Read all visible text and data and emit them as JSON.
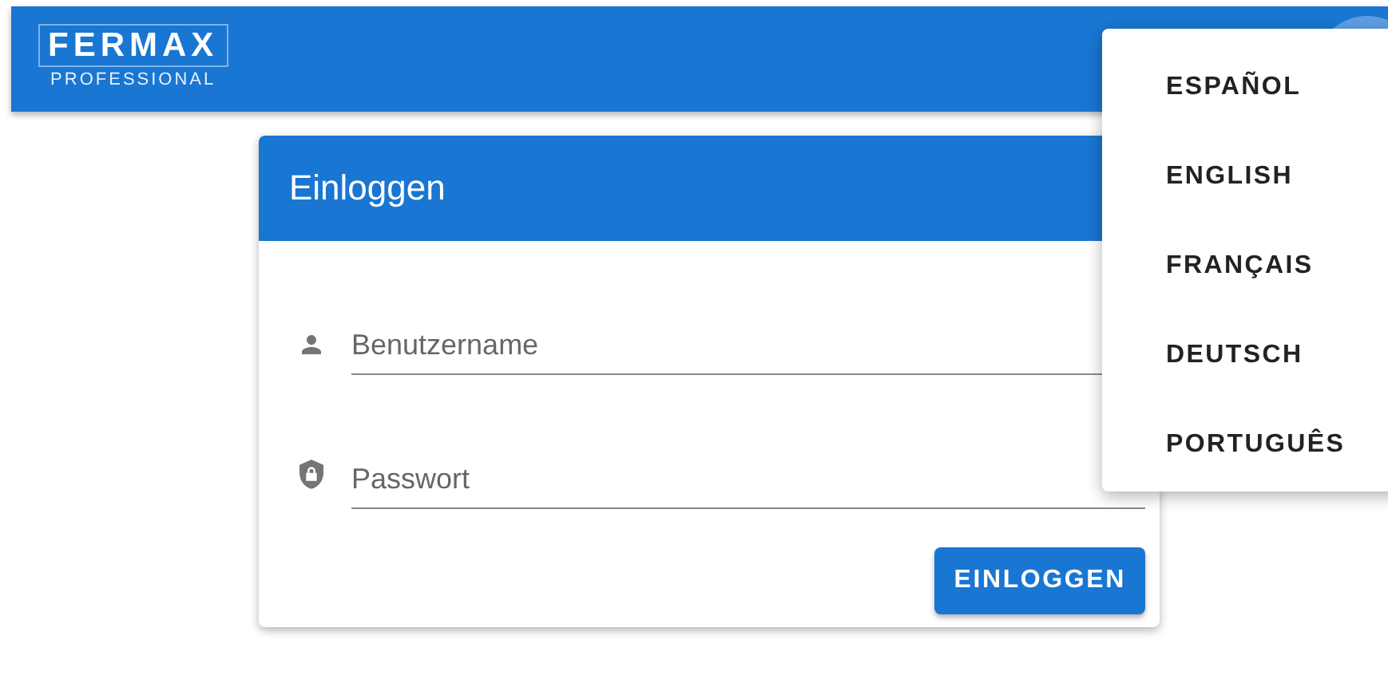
{
  "header": {
    "logo": {
      "brand": "FERMAX",
      "tagline": "PROFESSIONAL"
    }
  },
  "login_card": {
    "title": "Einloggen",
    "fields": [
      {
        "kind": "user",
        "placeholder": "Benutzername"
      },
      {
        "kind": "password",
        "placeholder": "Passwort"
      }
    ],
    "submit_button": "EINLOGGEN"
  },
  "language_menu": {
    "items": [
      {
        "label": "ESPAÑOL"
      },
      {
        "label": "ENGLISH"
      },
      {
        "label": "FRANÇAIS"
      },
      {
        "label": "DEUTSCH"
      },
      {
        "label": "PORTUGUÊS"
      }
    ]
  }
}
